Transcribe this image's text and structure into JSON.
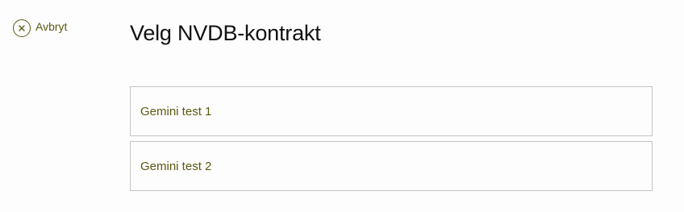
{
  "nav": {
    "cancel_label": "Avbryt",
    "cancel_icon": "close-circle-icon"
  },
  "page": {
    "title": "Velg NVDB-kontrakt"
  },
  "contracts": [
    {
      "label": "Gemini test 1"
    },
    {
      "label": "Gemini test 2"
    }
  ],
  "colors": {
    "accent": "#5b5a12",
    "border": "#c4c4c4",
    "title": "#111111",
    "background": "#fdfdfd"
  }
}
